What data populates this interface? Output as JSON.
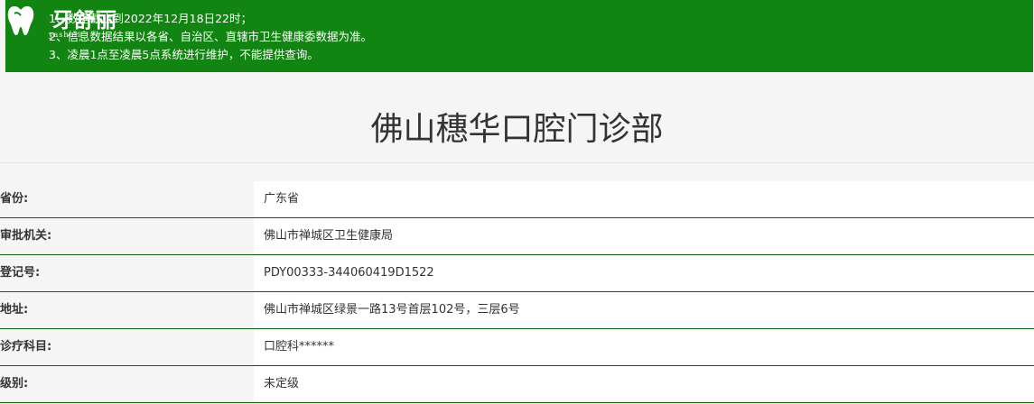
{
  "notice": {
    "lines": [
      "1、数据截止到2022年12月18日22时；",
      "2、信息数据结果以各省、自治区、直辖市卫生健康委数据为准。",
      "3、凌晨1点至凌晨5点系统进行维护，不能提供查询。"
    ],
    "colors": {
      "background": "#128412",
      "text": "#ffffff"
    }
  },
  "logo": {
    "text": "牙舒丽",
    "subtext": "yashuli"
  },
  "clinic": {
    "name": "佛山穗华口腔门诊部"
  },
  "info_rows": [
    {
      "label": "省份:",
      "value": "广东省"
    },
    {
      "label": "审批机关:",
      "value": "佛山市禅城区卫生健康局"
    },
    {
      "label": "登记号:",
      "value": "PDY00333-344060419D1522"
    },
    {
      "label": "地址:",
      "value": "佛山市禅城区绿景一路13号首层102号，三层6号"
    },
    {
      "label": "诊疗科目:",
      "value": "口腔科******"
    },
    {
      "label": "级别:",
      "value": "未定级"
    }
  ]
}
